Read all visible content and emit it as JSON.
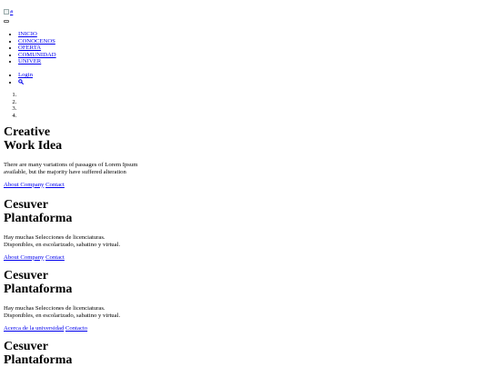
{
  "logo": {
    "alt": "#"
  },
  "nav": {
    "items": [
      "INICIO",
      "CONOCENOS",
      "OFERTA",
      "COMUNIDAD",
      "UNIVER"
    ]
  },
  "tools": {
    "login": "Login",
    "search_icon": "search-icon"
  },
  "indicators": [
    "",
    "",
    "",
    ""
  ],
  "slides": [
    {
      "title_line1": "Creative",
      "title_line2": "Work Idea",
      "text_line1": "There are many variations of passages of Lorem Ipsum",
      "text_line2": "available, but the majority have suffered alteration",
      "link1": "About Company",
      "link2": "Contact"
    },
    {
      "title_line1": "Cesuver",
      "title_line2": "Plantaforma",
      "text_line1": "Hay muchas Selecciones de licenciaturas.",
      "text_line2": "Disponibles, en escolarizado, sabatino y virtual.",
      "link1": "About Company",
      "link2": "Contact"
    },
    {
      "title_line1": "Cesuver",
      "title_line2": "Plantaforma",
      "text_line1": "Hay muchas Selecciones de licenciaturas.",
      "text_line2": "Disponibles, en escolarizado, sabatino y virtual.",
      "link1": "Acerca de la universidad",
      "link2": "Contacto"
    },
    {
      "title_line1": "Cesuver",
      "title_line2": "Plantaforma"
    }
  ]
}
